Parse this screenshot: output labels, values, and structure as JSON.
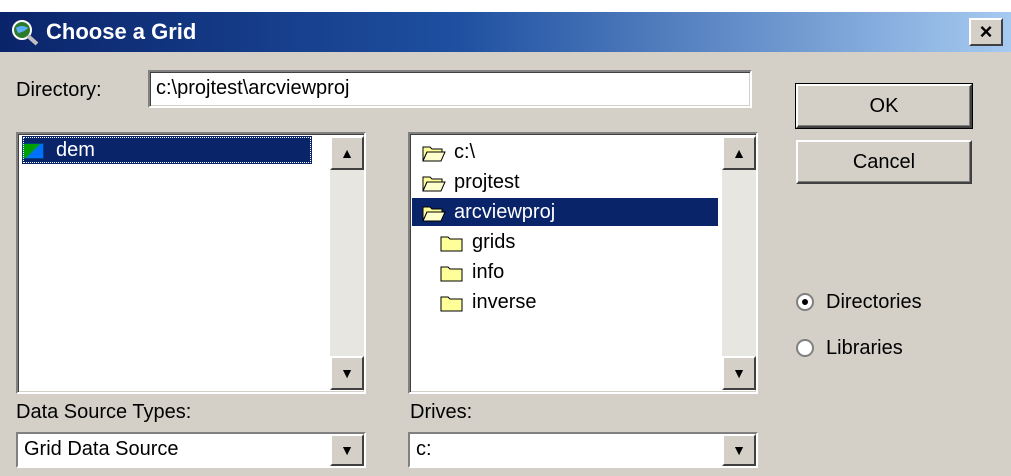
{
  "window": {
    "title": "Choose a Grid",
    "close_label": "×"
  },
  "directory": {
    "label": "Directory:",
    "value": "c:\\projtest\\arcviewproj"
  },
  "grid_list": {
    "items": [
      {
        "label": "dem",
        "icon": "grid-icon",
        "selected": true
      }
    ]
  },
  "folder_tree": {
    "items": [
      {
        "label": "c:\\",
        "icon": "open-folder-icon"
      },
      {
        "label": "projtest",
        "icon": "open-folder-icon"
      },
      {
        "label": "arcviewproj",
        "icon": "open-folder-icon",
        "selected": true
      },
      {
        "label": "grids",
        "icon": "folder-icon"
      },
      {
        "label": "info",
        "icon": "folder-icon"
      },
      {
        "label": "inverse",
        "icon": "folder-icon"
      }
    ]
  },
  "buttons": {
    "ok": "OK",
    "cancel": "Cancel"
  },
  "view_mode": {
    "directories": "Directories",
    "libraries": "Libraries",
    "selected": "Directories"
  },
  "data_source_types": {
    "label": "Data Source Types:",
    "value": "Grid Data Source"
  },
  "drives": {
    "label": "Drives:",
    "value": "c:"
  },
  "colors": {
    "title_bar": "#0a246a",
    "selection": "#0a246a",
    "dialog_bg": "#d4d0c8"
  }
}
